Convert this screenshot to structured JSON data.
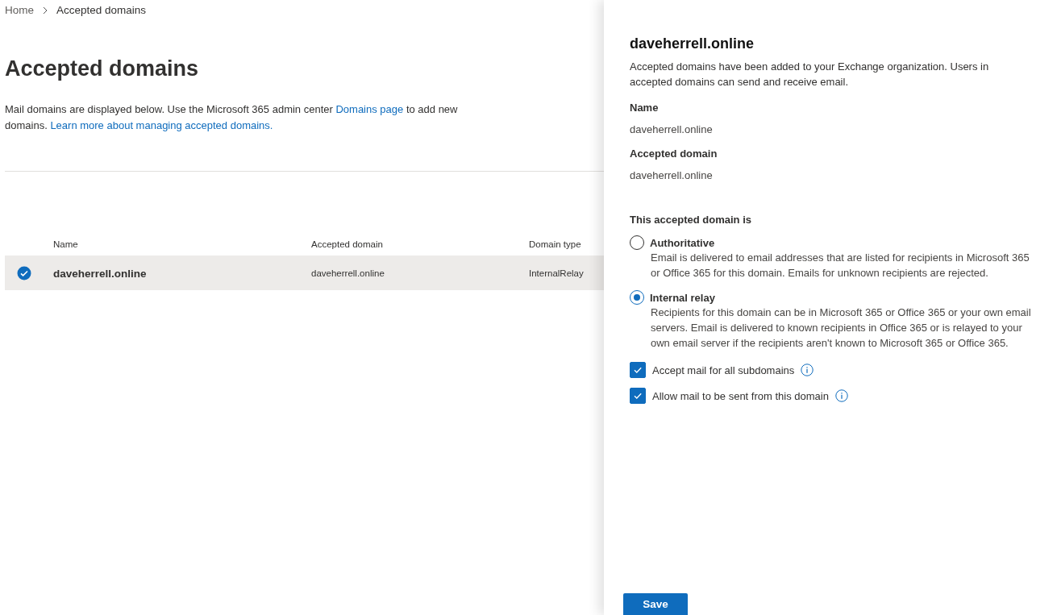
{
  "breadcrumb": [
    {
      "label": "Home",
      "current": false
    },
    {
      "label": "Accepted domains",
      "current": true
    }
  ],
  "page": {
    "title": "Accepted domains",
    "description": [
      {
        "kind": "text",
        "text": "Mail domains are displayed below. Use the Microsoft 365 admin center "
      },
      {
        "kind": "link",
        "text": "Domains page"
      },
      {
        "kind": "text",
        "text": " to add new domains. "
      },
      {
        "kind": "link",
        "text": "Learn more about managing accepted domains."
      }
    ]
  },
  "table": {
    "columns": [
      "Name",
      "Accepted domain",
      "Domain type"
    ],
    "rows": [
      {
        "selected": true,
        "cells": [
          "daveherrell.online",
          "daveherrell.online",
          "InternalRelay"
        ]
      }
    ]
  },
  "panel": {
    "title": "daveherrell.online",
    "intro": "Accepted domains have been added to your Exchange organization. Users in accepted domains can send and receive email.",
    "fields": [
      {
        "label": "Name",
        "value": "daveherrell.online"
      },
      {
        "label": "Accepted domain",
        "value": "daveherrell.online"
      }
    ],
    "radio_group": {
      "label": "This accepted domain is",
      "options": [
        {
          "label": "Authoritative",
          "selected": false,
          "description": "Email is delivered to email addresses that are listed for recipients in Microsoft 365 or Office 365 for this domain. Emails for unknown recipients are rejected."
        },
        {
          "label": "Internal relay",
          "selected": true,
          "description": "Recipients for this domain can be in Microsoft 365 or Office 365 or your own email servers. Email is delivered to known recipients in Office 365 or is relayed to your own email server if the recipients aren't known to Microsoft 365 or Office 365."
        }
      ]
    },
    "checkboxes": [
      {
        "label": "Accept mail for all subdomains",
        "checked": true
      },
      {
        "label": "Allow mail to be sent from this domain",
        "checked": true
      }
    ],
    "save_button": "Save"
  }
}
